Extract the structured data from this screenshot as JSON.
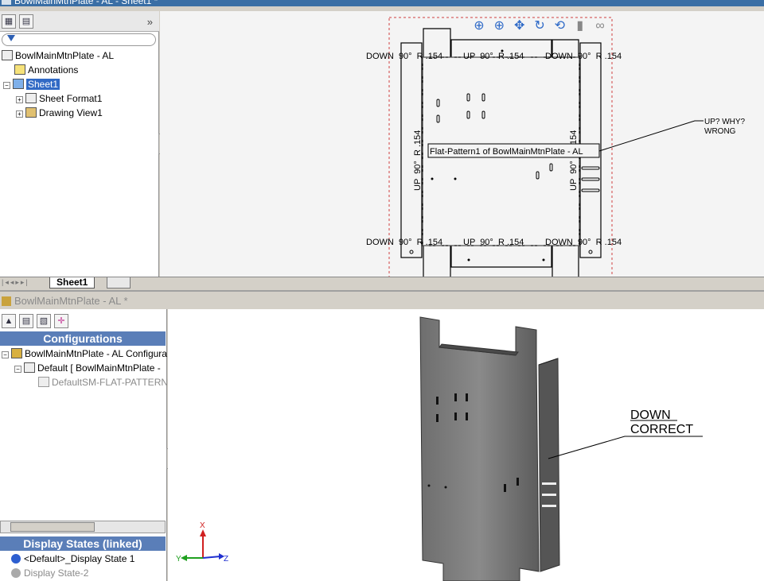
{
  "top_window": {
    "title": "BowlMainMtnPlate - AL - Sheet1 *"
  },
  "feature_tree": {
    "expand_symbol": "»",
    "items": [
      {
        "label": "BowlMainMtnPlate - AL"
      },
      {
        "label": "Annotations"
      },
      {
        "label": "Sheet1"
      },
      {
        "label": "Sheet Format1"
      },
      {
        "label": "Drawing View1"
      }
    ]
  },
  "drawing": {
    "bend_notes_top": [
      "DOWN  90°  R .154",
      "UP  90°  R .154",
      "DOWN  90°  R .154"
    ],
    "bend_notes_bottom": [
      "DOWN  90°  R .154",
      "UP  90°  R .154",
      "DOWN  90°  R .154"
    ],
    "bend_note_vertical": "UP  90°  R .154",
    "view_label": "Flat-Pattern1 of BowlMainMtnPlate - AL",
    "note_line1": "UP? WHY?",
    "note_line2": "WRONG"
  },
  "sheet_tabs": {
    "active": "Sheet1"
  },
  "bottom_window": {
    "title": "BowlMainMtnPlate - AL *",
    "configurations_header": "Configurations",
    "config_items": [
      {
        "label": "BowlMainMtnPlate - AL Configura"
      },
      {
        "label": "Default [ BowlMainMtnPlate -"
      },
      {
        "label": "DefaultSM-FLAT-PATTERN"
      }
    ],
    "display_states_header": "Display States (linked)",
    "display_states": [
      {
        "label": "<Default>_Display State 1"
      },
      {
        "label": "Display State-2"
      }
    ],
    "model_note_line1": "DOWN",
    "model_note_line2": "CORRECT",
    "triad": {
      "x": "X",
      "y": "Y",
      "z": "Z"
    }
  },
  "colors": {
    "accent": "#5a7eb8",
    "selection": "#316ac5",
    "sheet_border": "#d04040"
  }
}
